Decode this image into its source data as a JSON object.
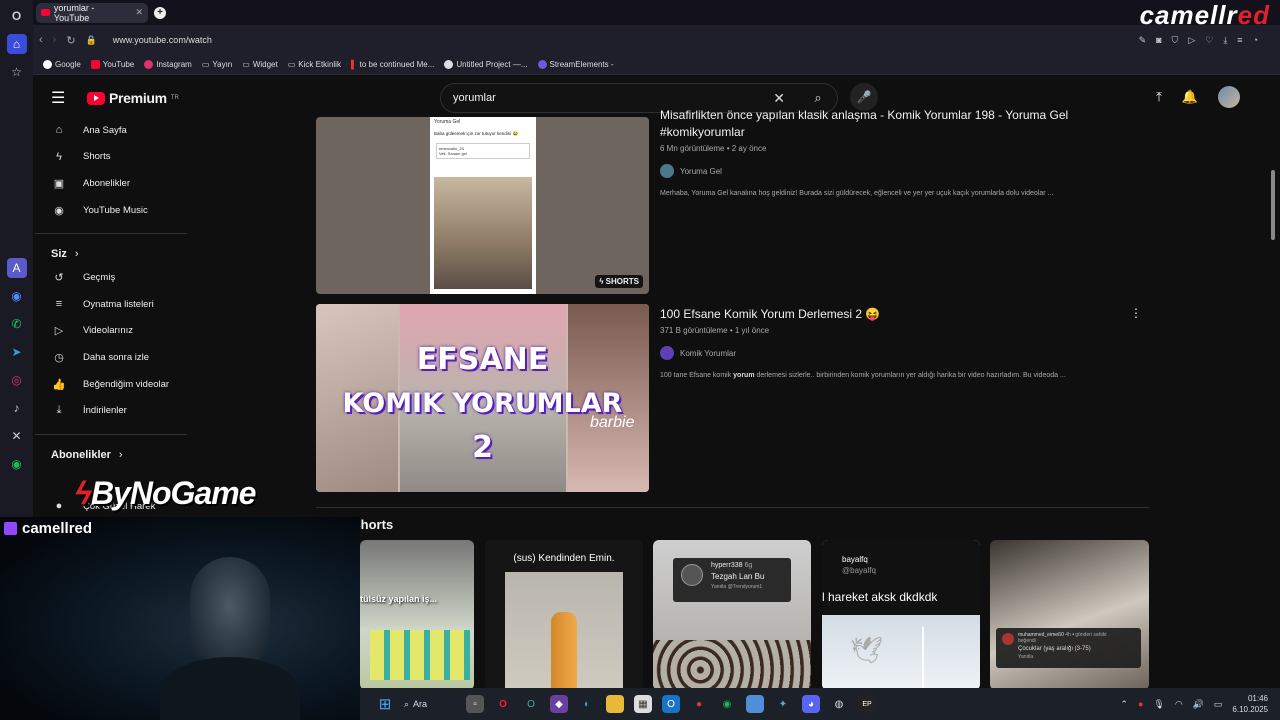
{
  "browser": {
    "tab_title": "yorumlar - YouTube",
    "url": "www.youtube.com/watch",
    "bookmarks": [
      "Google",
      "YouTube",
      "Instagram",
      "Yayın",
      "Widget",
      "Kick Etkinlik",
      "to be continued Me...",
      "Untitled Project —...",
      "StreamElements -"
    ]
  },
  "overlay": {
    "brand_left": "camellr",
    "brand_right": "ed",
    "cam_name": "camellred",
    "sponsor": "ByNoGame"
  },
  "youtube": {
    "logo": "Premium",
    "logo_sup": "TR",
    "search_value": "yorumlar",
    "nav": [
      {
        "label": "Ana Sayfa",
        "icon": "home-icon",
        "glyph": "⌂"
      },
      {
        "label": "Shorts",
        "icon": "shorts-icon",
        "glyph": "ϟ"
      },
      {
        "label": "Abonelikler",
        "icon": "subscriptions-icon",
        "glyph": "▣"
      },
      {
        "label": "YouTube Music",
        "icon": "music-icon",
        "glyph": "◉"
      }
    ],
    "you_section": "Siz",
    "you_items": [
      {
        "label": "Geçmiş",
        "icon": "history-icon",
        "glyph": "↺"
      },
      {
        "label": "Oynatma listeleri",
        "icon": "playlist-icon",
        "glyph": "≡"
      },
      {
        "label": "Videolarınız",
        "icon": "your-videos-icon",
        "glyph": "▷"
      },
      {
        "label": "Daha sonra izle",
        "icon": "watch-later-icon",
        "glyph": "◷"
      },
      {
        "label": "Beğendiğim videolar",
        "icon": "like-icon",
        "glyph": "👍"
      },
      {
        "label": "İndirilenler",
        "icon": "download-icon",
        "glyph": "⤓"
      }
    ],
    "subs_section": "Abonelikler",
    "subs_partial": "Çok Güzel Harek",
    "videos": [
      {
        "title": "Misafirlikten önce yapılan klasik anlaşma - Komik Yorumlar 198 - Yoruma Gel #komikyorumlar",
        "meta": "6 Mn görüntüleme • 2 ay önce",
        "channel": "Yoruma Gel",
        "desc": "Merhaba, Yoruma Gel kanalına hoş geldiniz! Burada sizi güldürecek, eğlenceli ve yer yer uçuk kaçık yorumlarla dolu videolar ...",
        "badge": "SHORTS",
        "inner_channel": "Yoruma Gel",
        "inner_caption": "Baba güleemek için zor tutuyor kendini 😂",
        "inner_comment_user": "emeocaliu_24",
        "inner_comment": "Veli, Sanam gel"
      },
      {
        "title": "100 Efsane Komik Yorum Derlemesi 2 😝",
        "meta": "371 B görüntüleme • 1 yıl önce",
        "channel": "Komik Yorumlar",
        "desc_pre": "100 tane Efsane komik ",
        "desc_bold": "yorum",
        "desc_post": " derlemesi sizlerle.. birbirinden komik yorumların yer aldığı harika bir video hazırladım. Bu videoda ...",
        "thumb_text": [
          "EFSANE",
          "KOMIK YORUMLAR",
          "2"
        ],
        "thumb_side": "barbie"
      }
    ],
    "shorts_heading": "Shorts",
    "shorts": [
      {
        "text": "tülsüz yapılan iş..."
      },
      {
        "text": "(sus) Kendinden Emin."
      },
      {
        "user": "hyperr338",
        "age": "6g",
        "comment": "Tezgah Lan Bu",
        "reply": "Yanıtla",
        "tag": "@Trendyorum1"
      },
      {
        "user": "bayalfq",
        "handle": "@bayalfq",
        "text": "l hareket aksk dkdkdk"
      },
      {
        "user": "muhammed_eimeß0",
        "age": "4h",
        "status": "gönderi sahibi",
        "liked": "beğendi",
        "comment": "Çocuklar (yaş aralığı (3-75)",
        "reply": "Yanıtla"
      }
    ]
  },
  "taskbar": {
    "search": "Ara",
    "time": "01:46",
    "date": "6.10.2025"
  }
}
